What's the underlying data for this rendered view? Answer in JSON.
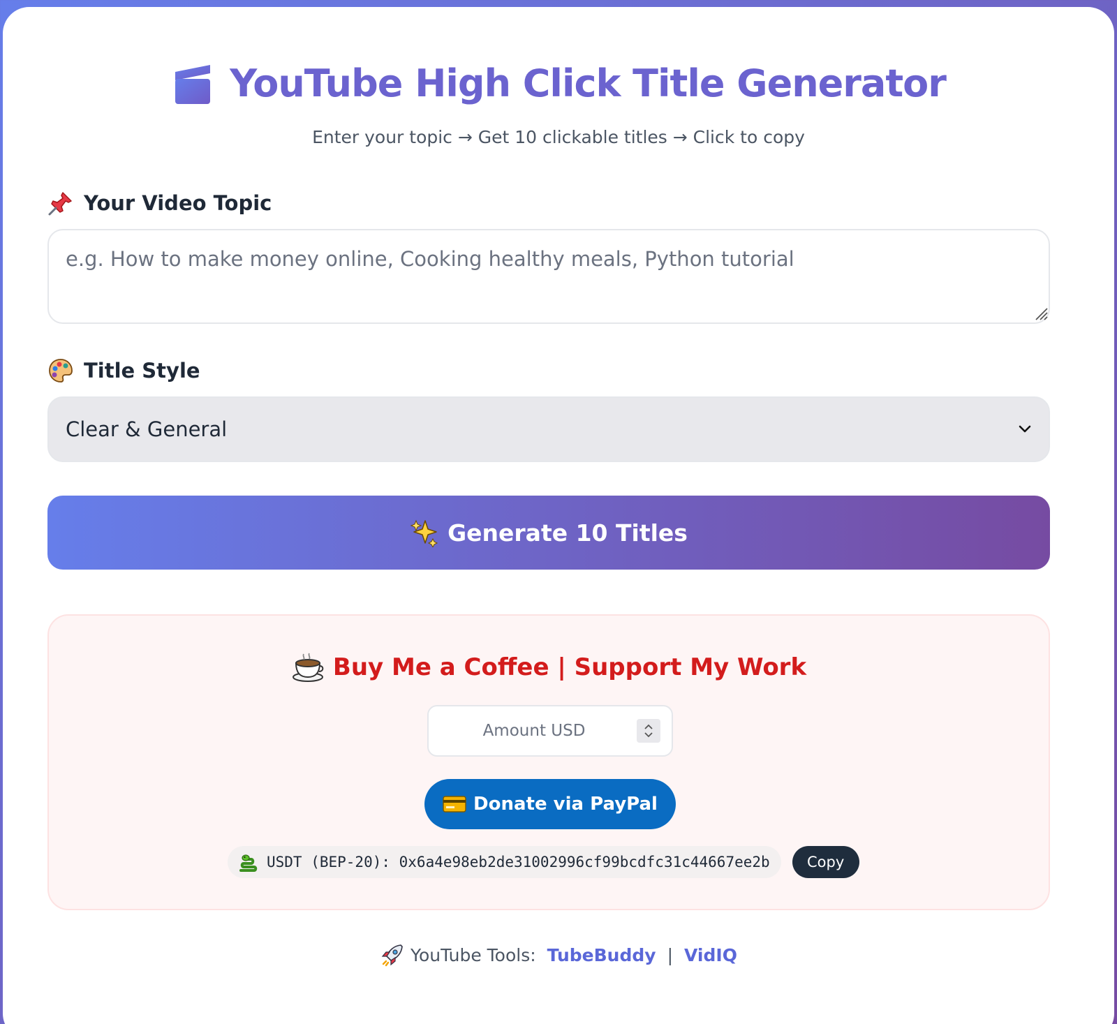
{
  "header": {
    "title": "YouTube High Click Title Generator",
    "subtitle": "Enter your topic → Get 10 clickable titles → Click to copy"
  },
  "topic": {
    "label": "Your Video Topic",
    "placeholder": "e.g. How to make money online, Cooking healthy meals, Python tutorial",
    "value": ""
  },
  "style": {
    "label": "Title Style",
    "selected": "Clear & General"
  },
  "generate_button": {
    "label": "Generate 10 Titles"
  },
  "donate": {
    "title": "Buy Me a Coffee | Support My Work",
    "amount_placeholder": "Amount USD",
    "paypal_label": "Donate via PayPal",
    "usdt_text": "USDT (BEP-20): 0x6a4e98eb2de31002996cf99bcdfc31c44667ee2b",
    "copy_label": "Copy"
  },
  "footer": {
    "prefix": "YouTube Tools:",
    "links": [
      "TubeBuddy",
      "VidIQ"
    ],
    "separator": "|"
  },
  "colors": {
    "gradient_start": "#667eea",
    "gradient_end": "#764ba2",
    "title_color": "#6b63cf",
    "donate_title_color": "#d31c1c",
    "paypal_blue": "#0a6cc2",
    "copy_button": "#1f2d3d",
    "link_color": "#5a67d8"
  },
  "icons": {
    "title": "clapper-board-icon",
    "topic": "pushpin-icon",
    "style": "artist-palette-icon",
    "generate": "sparkles-icon",
    "donate": "coffee-icon",
    "paypal": "credit-card-icon",
    "usdt": "snake-icon",
    "footer": "rocket-icon",
    "select": "chevron-down-icon"
  }
}
